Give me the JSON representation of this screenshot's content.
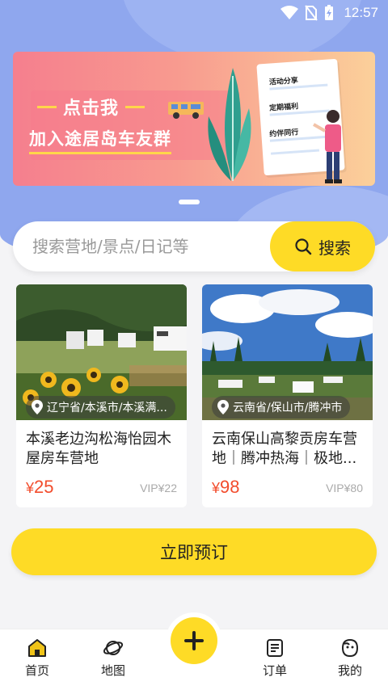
{
  "status_bar": {
    "time": "12:57"
  },
  "banner": {
    "line1": "点击我",
    "line2": "加入途居岛车友群",
    "list": [
      "活动分享",
      "定期福利",
      "约伴同行"
    ]
  },
  "search": {
    "placeholder": "搜索营地/景点/日记等",
    "button_label": "搜索"
  },
  "cards": [
    {
      "location": "辽宁省/本溪市/本溪满...",
      "name": "本溪老边沟松海怡园木屋房车营地",
      "price_symbol": "¥",
      "price": "25",
      "vip": "VIP¥22"
    },
    {
      "location": "云南省/保山市/腾冲市",
      "name": "云南保山高黎贡房车营地｜腾冲热海｜极地...",
      "price_symbol": "¥",
      "price": "98",
      "vip": "VIP¥80"
    }
  ],
  "book_button": "立即预订",
  "nav": {
    "home": "首页",
    "map": "地图",
    "orders": "订单",
    "mine": "我的"
  },
  "colors": {
    "accent": "#fedb26",
    "header_blue": "#8fa7ee",
    "price_red": "#f24c2c"
  }
}
